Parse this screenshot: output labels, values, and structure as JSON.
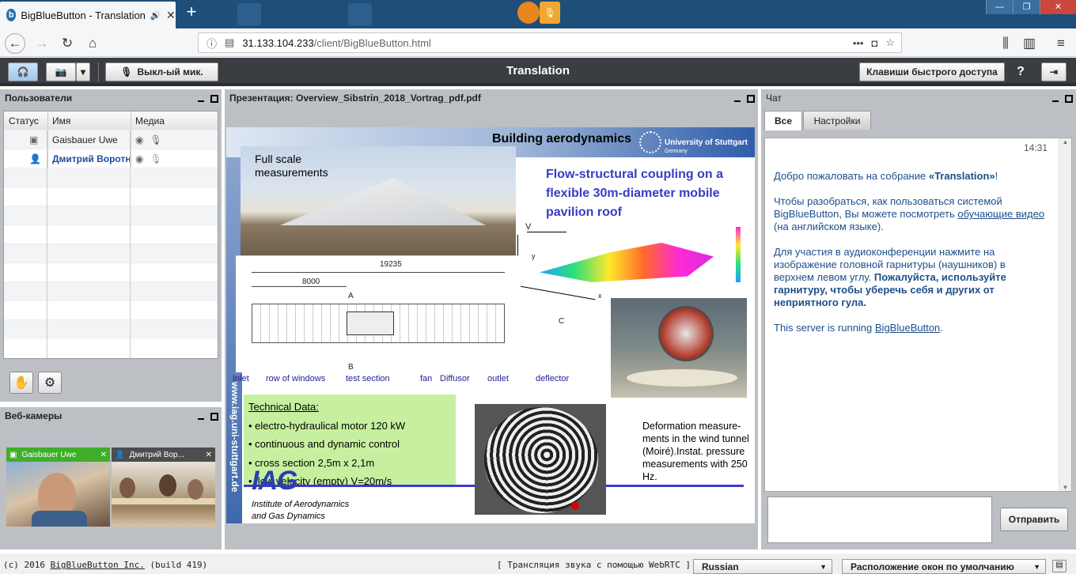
{
  "browser": {
    "tab_title": "BigBlueButton - Translation",
    "url_host": "31.133.104.233",
    "url_path": "/client/BigBlueButton.html"
  },
  "toolbar": {
    "mic_label": "Выкл-ый мик.",
    "title": "Translation",
    "shortcuts_label": "Клавиши быстрого доступа",
    "help_label": "?"
  },
  "users": {
    "title": "Пользователи",
    "columns": [
      "Статус",
      "Имя",
      "Медиа"
    ],
    "rows": [
      {
        "name": "Gaisbauer Uwe"
      },
      {
        "name": "Дмитрий Воротни"
      }
    ]
  },
  "webcams": {
    "title": "Веб-камеры",
    "cams": [
      {
        "name": "Gaisbauer Uwe"
      },
      {
        "name": "Дмитрий Вор..."
      }
    ]
  },
  "presentation": {
    "title": "Презентация: Overview_Sibstrin_2018_Vortrag_pdf.pdf",
    "slide": {
      "header": "Building aerodynamics",
      "uni": "University of Stuttgart",
      "uni_sub": "Germany",
      "photo_caption": "Full scale measurements",
      "headline": "Flow-structural coupling on a flexible 30m-diameter mobile pavilion roof",
      "dim1": "19235",
      "dim2": "8000",
      "dimA": "A",
      "dimB": "B",
      "dimC": "C",
      "axisV": "V",
      "axisX": "x",
      "axisY": "y",
      "labels": [
        "Inlet",
        "row of windows",
        "test section",
        "fan",
        "Diffusor",
        "outlet",
        "deflector"
      ],
      "tech_title": "Technical Data:",
      "tech_items": [
        "• electro-hydraulical motor 120 kW",
        "• continuous and dynamic control",
        "• cross section 2,5m x 2,1m",
        "• flow velocity (empty) V=20m/s"
      ],
      "deform": "Deformation measure-ments in the wind tunnel (Moiré).Instat. pressure measurements with 250 Hz.",
      "iag": "IAG",
      "iag_sub1": "Institute of Aerodynamics",
      "iag_sub2": "and Gas Dynamics",
      "side_url": "www.iag.uni-stuttgart.de"
    }
  },
  "chat": {
    "title": "Чат",
    "tab_all": "Все",
    "tab_settings": "Настройки",
    "time": "14:31",
    "msg1_pre": "Добро пожаловать на собрание ",
    "msg1_bold": "«Translation»",
    "msg1_post": "!",
    "msg2_pre": "Чтобы разобраться, как пользоваться системой BigBlueButton, Вы можете посмотреть ",
    "msg2_link": "обучающие видео",
    "msg2_post": " (на английском языке).",
    "msg3_pre": "Для участия в аудиоконференции нажмите на изображение головной гарнитуры (наушников) в верхнем левом углу. ",
    "msg3_bold": "Пожалуйста, используйте гарнитуру, чтобы уберечь себя и других от неприятного гула.",
    "msg4_pre": "This server is running ",
    "msg4_link": "BigBlueButton",
    "msg4_post": ".",
    "send_label": "Отправить"
  },
  "status": {
    "copyright_pre": "(c) 2016 ",
    "copyright_link": "BigBlueButton Inc.",
    "copyright_post": " (build 419)",
    "webrtc": "[ Трансляция звука с помощью WebRTC ]",
    "language": "Russian",
    "layout": "Расположение окон по умолчанию"
  }
}
